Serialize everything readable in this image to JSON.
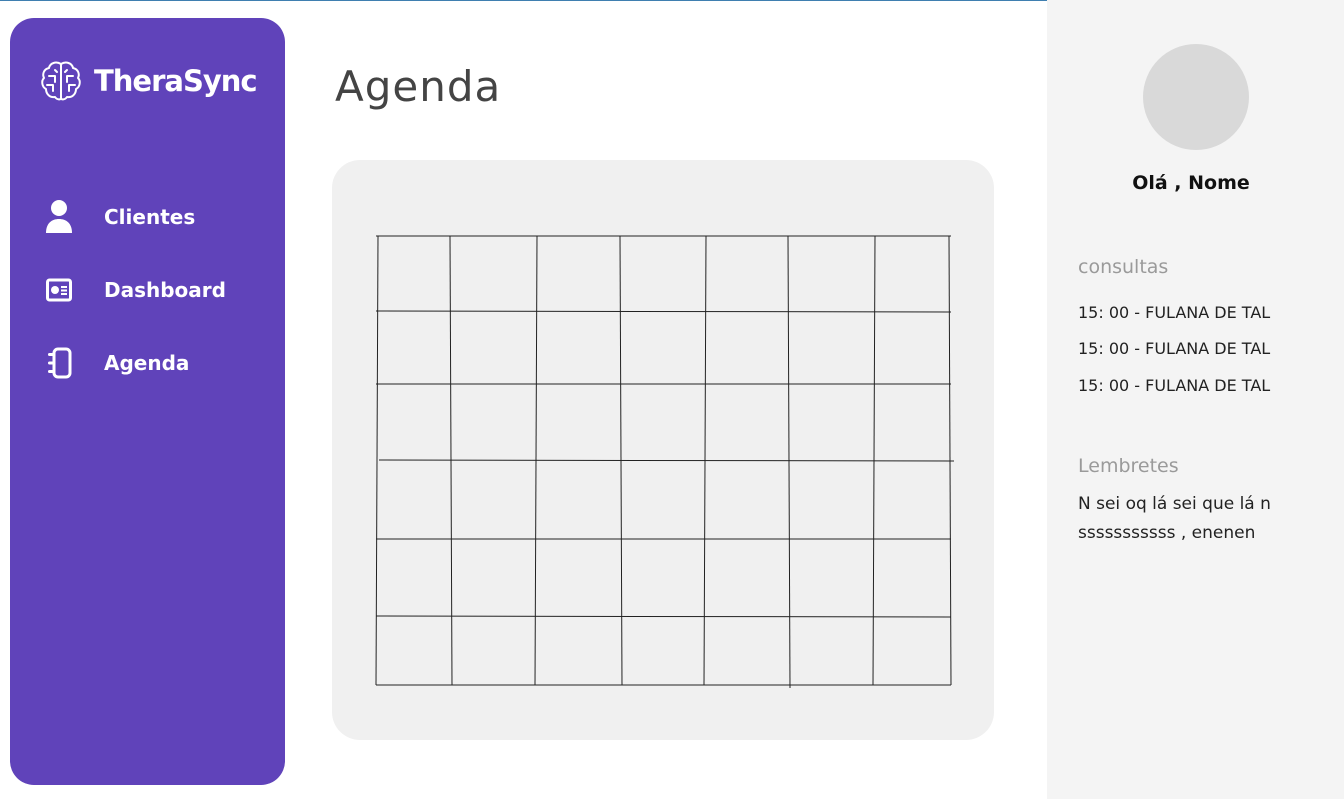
{
  "app": {
    "name": "TheraSync"
  },
  "sidebar": {
    "items": [
      {
        "label": "Clientes",
        "icon": "user-icon"
      },
      {
        "label": "Dashboard",
        "icon": "dashboard-icon"
      },
      {
        "label": "Agenda",
        "icon": "notebook-icon"
      }
    ]
  },
  "main": {
    "title": "Agenda"
  },
  "calendar": {
    "columns": 7,
    "rows": 6
  },
  "profile": {
    "greeting": "Olá , Nome"
  },
  "consultas": {
    "title": "consultas",
    "items": [
      "15: 00 - FULANA DE TAL",
      "15: 00 - FULANA DE TAL",
      "15: 00 - FULANA DE TAL"
    ]
  },
  "lembretes": {
    "title": "Lembretes",
    "text": "N sei oq lá sei que lá n sssssssssss , enenen"
  },
  "colors": {
    "sidebar": "#6043ba",
    "card": "#f0f0f0",
    "panel": "#f4f4f4",
    "avatar": "#d9d9d9"
  }
}
